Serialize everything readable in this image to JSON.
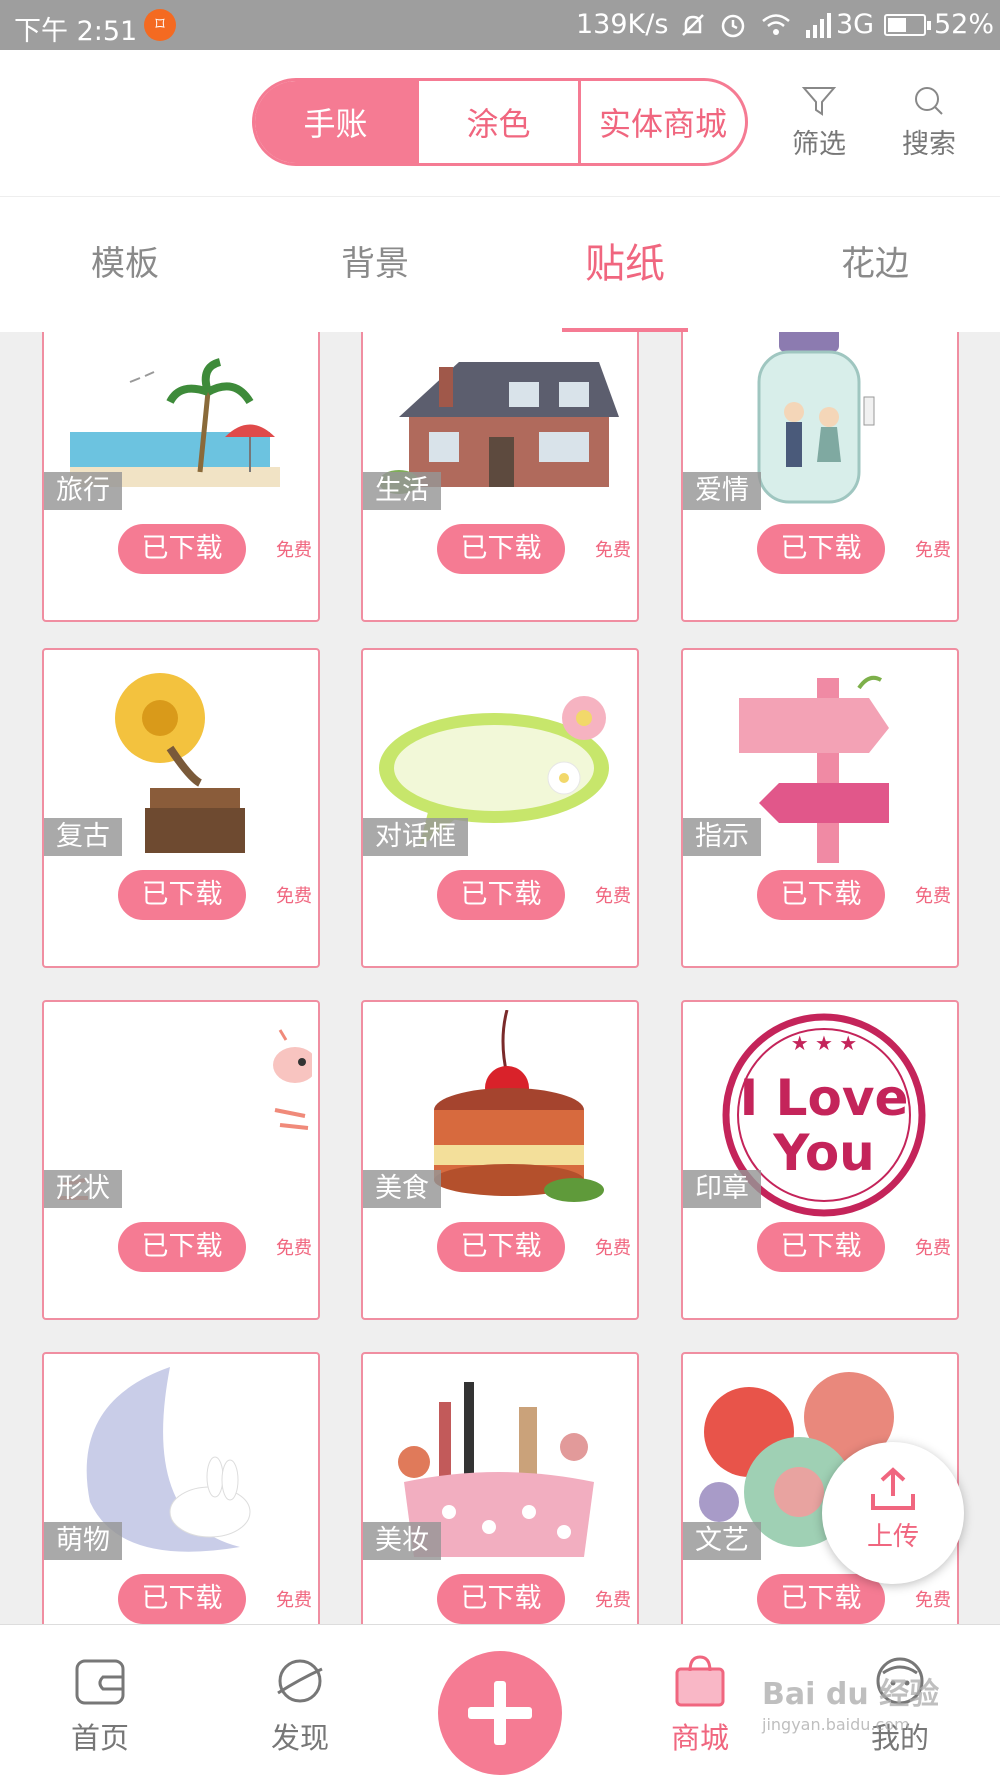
{
  "status_bar": {
    "time": "下午 2:51",
    "app_icon": "⌑",
    "speed": "139K/s",
    "network": "3G",
    "battery": "52%",
    "icons": [
      "bell-off-icon",
      "alarm-icon",
      "wifi-icon",
      "signal-icon"
    ]
  },
  "header": {
    "segments": [
      "手账",
      "涂色",
      "实体商城"
    ],
    "active_segment": "手账",
    "filter_label": "筛选",
    "search_label": "搜索"
  },
  "categories": {
    "items": [
      "模板",
      "背景",
      "贴纸",
      "花边"
    ],
    "active": "贴纸"
  },
  "stickers": [
    {
      "tag": "旅行",
      "button": "已下载",
      "price": "免费"
    },
    {
      "tag": "生活",
      "button": "已下载",
      "price": "免费"
    },
    {
      "tag": "爱情",
      "button": "已下载",
      "price": "免费"
    },
    {
      "tag": "复古",
      "button": "已下载",
      "price": "免费"
    },
    {
      "tag": "对话框",
      "button": "已下载",
      "price": "免费"
    },
    {
      "tag": "指示",
      "button": "已下载",
      "price": "免费"
    },
    {
      "tag": "形状",
      "button": "已下载",
      "price": "免费"
    },
    {
      "tag": "美食",
      "button": "已下载",
      "price": "免费"
    },
    {
      "tag": "印章",
      "button": "已下载",
      "price": "免费"
    },
    {
      "tag": "萌物",
      "button": "已下载",
      "price": "免费"
    },
    {
      "tag": "美妆",
      "button": "已下载",
      "price": "免费"
    },
    {
      "tag": "文艺",
      "button": "已下载",
      "price": "免费"
    }
  ],
  "stamp_text": {
    "line1": "I Love",
    "line2": "You"
  },
  "upload_label": "上传",
  "bottom_nav": {
    "home": "首页",
    "discover": "发现",
    "mall": "商城",
    "mine": "我的",
    "active": "商城"
  },
  "watermark": {
    "main": "Bai du 经验",
    "sub": "jingyan.baidu.com"
  },
  "colors": {
    "accent": "#f57b93",
    "accent_text": "#f0667f",
    "status_bar": "#9e9e9e"
  }
}
